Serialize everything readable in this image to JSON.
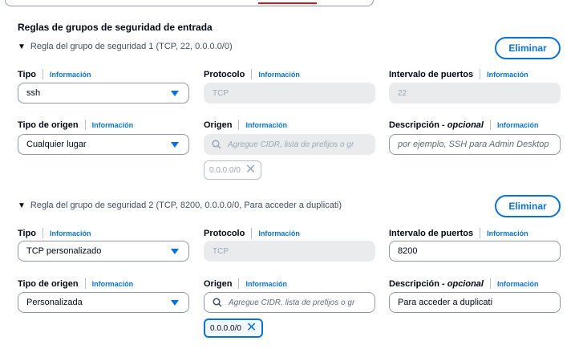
{
  "section_title": "Reglas de grupos de seguridad de entrada",
  "info_label": "Información",
  "rules": [
    {
      "header": "Regla del grupo de seguridad 1 (TCP, 22, 0.0.0.0/0)",
      "delete_label": "Eliminar",
      "type_label": "Tipo",
      "type_value": "ssh",
      "protocol_label": "Protocolo",
      "protocol_value": "TCP",
      "port_label": "Intervalo de puertos",
      "port_value": "22",
      "source_type_label": "Tipo de origen",
      "source_type_value": "Cualquier lugar",
      "source_label": "Origen",
      "source_placeholder": "Agregue CIDR, lista de prefijos o gr",
      "source_token": "0.0.0.0/0",
      "desc_label": "Descripción",
      "desc_optional": "opcional",
      "desc_value": "por ejemplo, SSH para Admin Desktop",
      "desc_is_placeholder": true
    },
    {
      "header": "Regla del grupo de seguridad 2 (TCP, 8200, 0.0.0.0/0, Para acceder a duplicati)",
      "delete_label": "Eliminar",
      "type_label": "Tipo",
      "type_value": "TCP personalizado",
      "protocol_label": "Protocolo",
      "protocol_value": "TCP",
      "port_label": "Intervalo de puertos",
      "port_value": "8200",
      "source_type_label": "Tipo de origen",
      "source_type_value": "Personalizada",
      "source_label": "Origen",
      "source_placeholder": "Agregue CIDR, lista de prefijos o gr",
      "source_token": "0.0.0.0/0",
      "desc_label": "Descripción",
      "desc_optional": "opcional",
      "desc_value": "Para acceder a duplicati",
      "desc_is_placeholder": false
    }
  ],
  "colors": {
    "accent": "#0972d3",
    "disabled_bg": "#e9ebed",
    "text": "#000716",
    "error_underline": "#d91515"
  }
}
